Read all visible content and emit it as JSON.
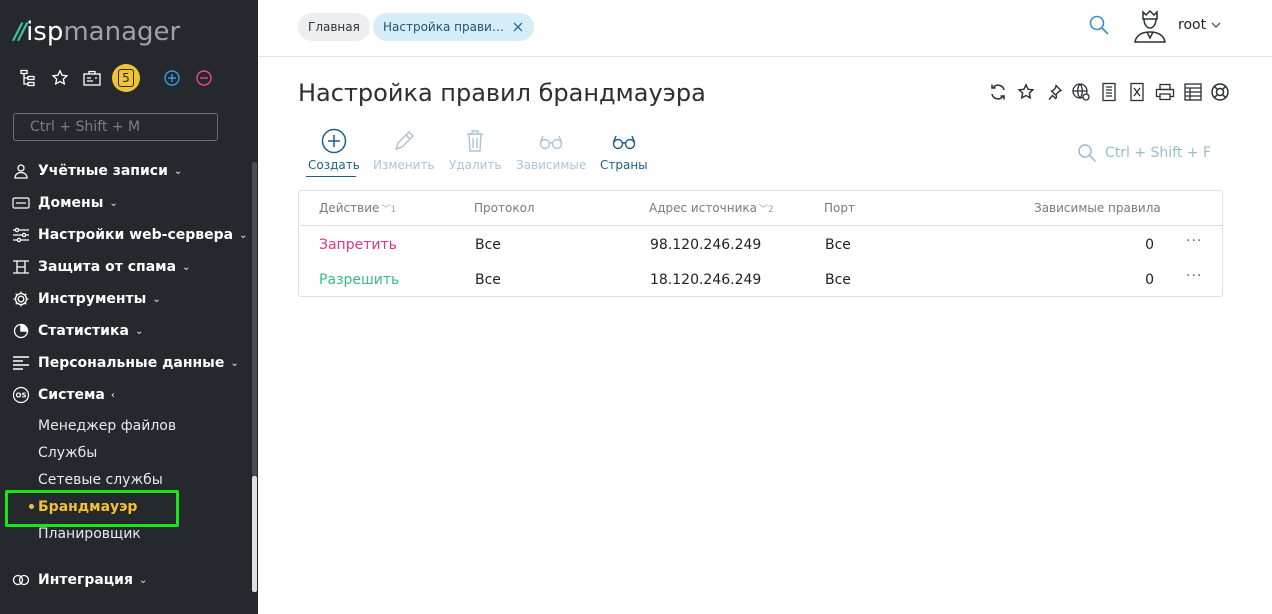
{
  "logo": {
    "mark": "//",
    "isp": "isp",
    "manager": "manager"
  },
  "toolbar": {
    "badge_count": "5"
  },
  "sidebar": {
    "search_placeholder": "Ctrl + Shift + M",
    "items": [
      {
        "label": "Учётные записи",
        "icon": "user-icon",
        "caret": "⌄"
      },
      {
        "label": "Домены",
        "icon": "domain-icon",
        "caret": "⌄"
      },
      {
        "label": "Настройки web-сервера",
        "icon": "sliders-icon",
        "caret": "⌄"
      },
      {
        "label": "Защита от спама",
        "icon": "shield-icon",
        "caret": "⌄"
      },
      {
        "label": "Инструменты",
        "icon": "gear-icon",
        "caret": "⌄"
      },
      {
        "label": "Статистика",
        "icon": "pie-icon",
        "caret": "⌄"
      },
      {
        "label": "Персональные данные",
        "icon": "list-icon",
        "caret": "⌄"
      },
      {
        "label": "Система",
        "icon": "os-icon",
        "caret": "‹"
      },
      {
        "label": "Интеграция",
        "icon": "link-icon",
        "caret": "⌄"
      }
    ],
    "subitems": [
      {
        "label": "Менеджер файлов"
      },
      {
        "label": "Службы"
      },
      {
        "label": "Сетевые службы"
      },
      {
        "label": "Брандмауэр",
        "active": true
      },
      {
        "label": "Планировщик"
      }
    ]
  },
  "header": {
    "crumb_home": "Главная",
    "crumb_tab": "Настройка прави…",
    "user": "root"
  },
  "page": {
    "title": "Настройка правил брандмауэра",
    "actions": [
      {
        "label": "Создать",
        "icon": "plus-circle-icon",
        "enabled": true
      },
      {
        "label": "Изменить",
        "icon": "pencil-icon",
        "enabled": false
      },
      {
        "label": "Удалить",
        "icon": "trash-icon",
        "enabled": false
      },
      {
        "label": "Зависимые",
        "icon": "glasses-icon",
        "enabled": false
      },
      {
        "label": "Страны",
        "icon": "glasses-icon",
        "enabled": true
      }
    ],
    "filter_placeholder": "Ctrl + Shift + F"
  },
  "table": {
    "columns": [
      {
        "label": "Действие",
        "sort": "1"
      },
      {
        "label": "Протокол",
        "sort": ""
      },
      {
        "label": "Адрес источника",
        "sort": "2"
      },
      {
        "label": "Порт",
        "sort": ""
      },
      {
        "label": "Зависимые правила",
        "sort": ""
      }
    ],
    "rows": [
      {
        "action": "Запретить",
        "type": "deny",
        "protocol": "Все",
        "source": "98.120.246.249",
        "port": "Все",
        "dependent": "0",
        "menu": "···"
      },
      {
        "action": "Разрешить",
        "type": "allow",
        "protocol": "Все",
        "source": "18.120.246.249",
        "port": "Все",
        "dependent": "0",
        "menu": "···"
      }
    ]
  },
  "colors": {
    "sidebar_bg": "#25282d",
    "accent_green": "#3cc29a",
    "active_yellow": "#f2c230",
    "deny_pink": "#d8358b",
    "allow_green": "#3bb88d",
    "link_blue": "#1e5d8c"
  }
}
